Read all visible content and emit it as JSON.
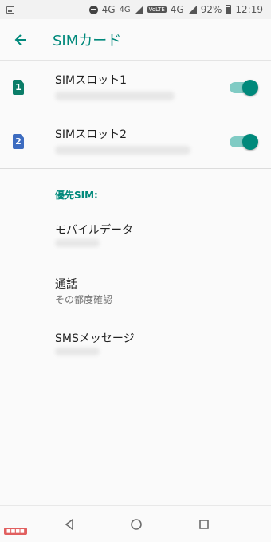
{
  "status_bar": {
    "network_1": "4G",
    "network_1_tag": "4G",
    "volte": "VoLTE",
    "network_2": "4G",
    "battery": "92%",
    "time": "12:19"
  },
  "app_bar": {
    "title": "SIMカード",
    "back_icon": "arrow-back-icon"
  },
  "sims": [
    {
      "slot": "1",
      "title": "SIMスロット1",
      "badge_color": "#0b7d68",
      "enabled": true
    },
    {
      "slot": "2",
      "title": "SIMスロット2",
      "badge_color": "#3d6cc0",
      "enabled": true
    }
  ],
  "preferred": {
    "header": "優先SIM:",
    "items": [
      {
        "title": "モバイルデータ",
        "subtitle": ""
      },
      {
        "title": "通話",
        "subtitle": "その都度確認"
      },
      {
        "title": "SMSメッセージ",
        "subtitle": ""
      }
    ]
  },
  "colors": {
    "accent": "#00897b",
    "toggle_track": "#80cbc4"
  }
}
